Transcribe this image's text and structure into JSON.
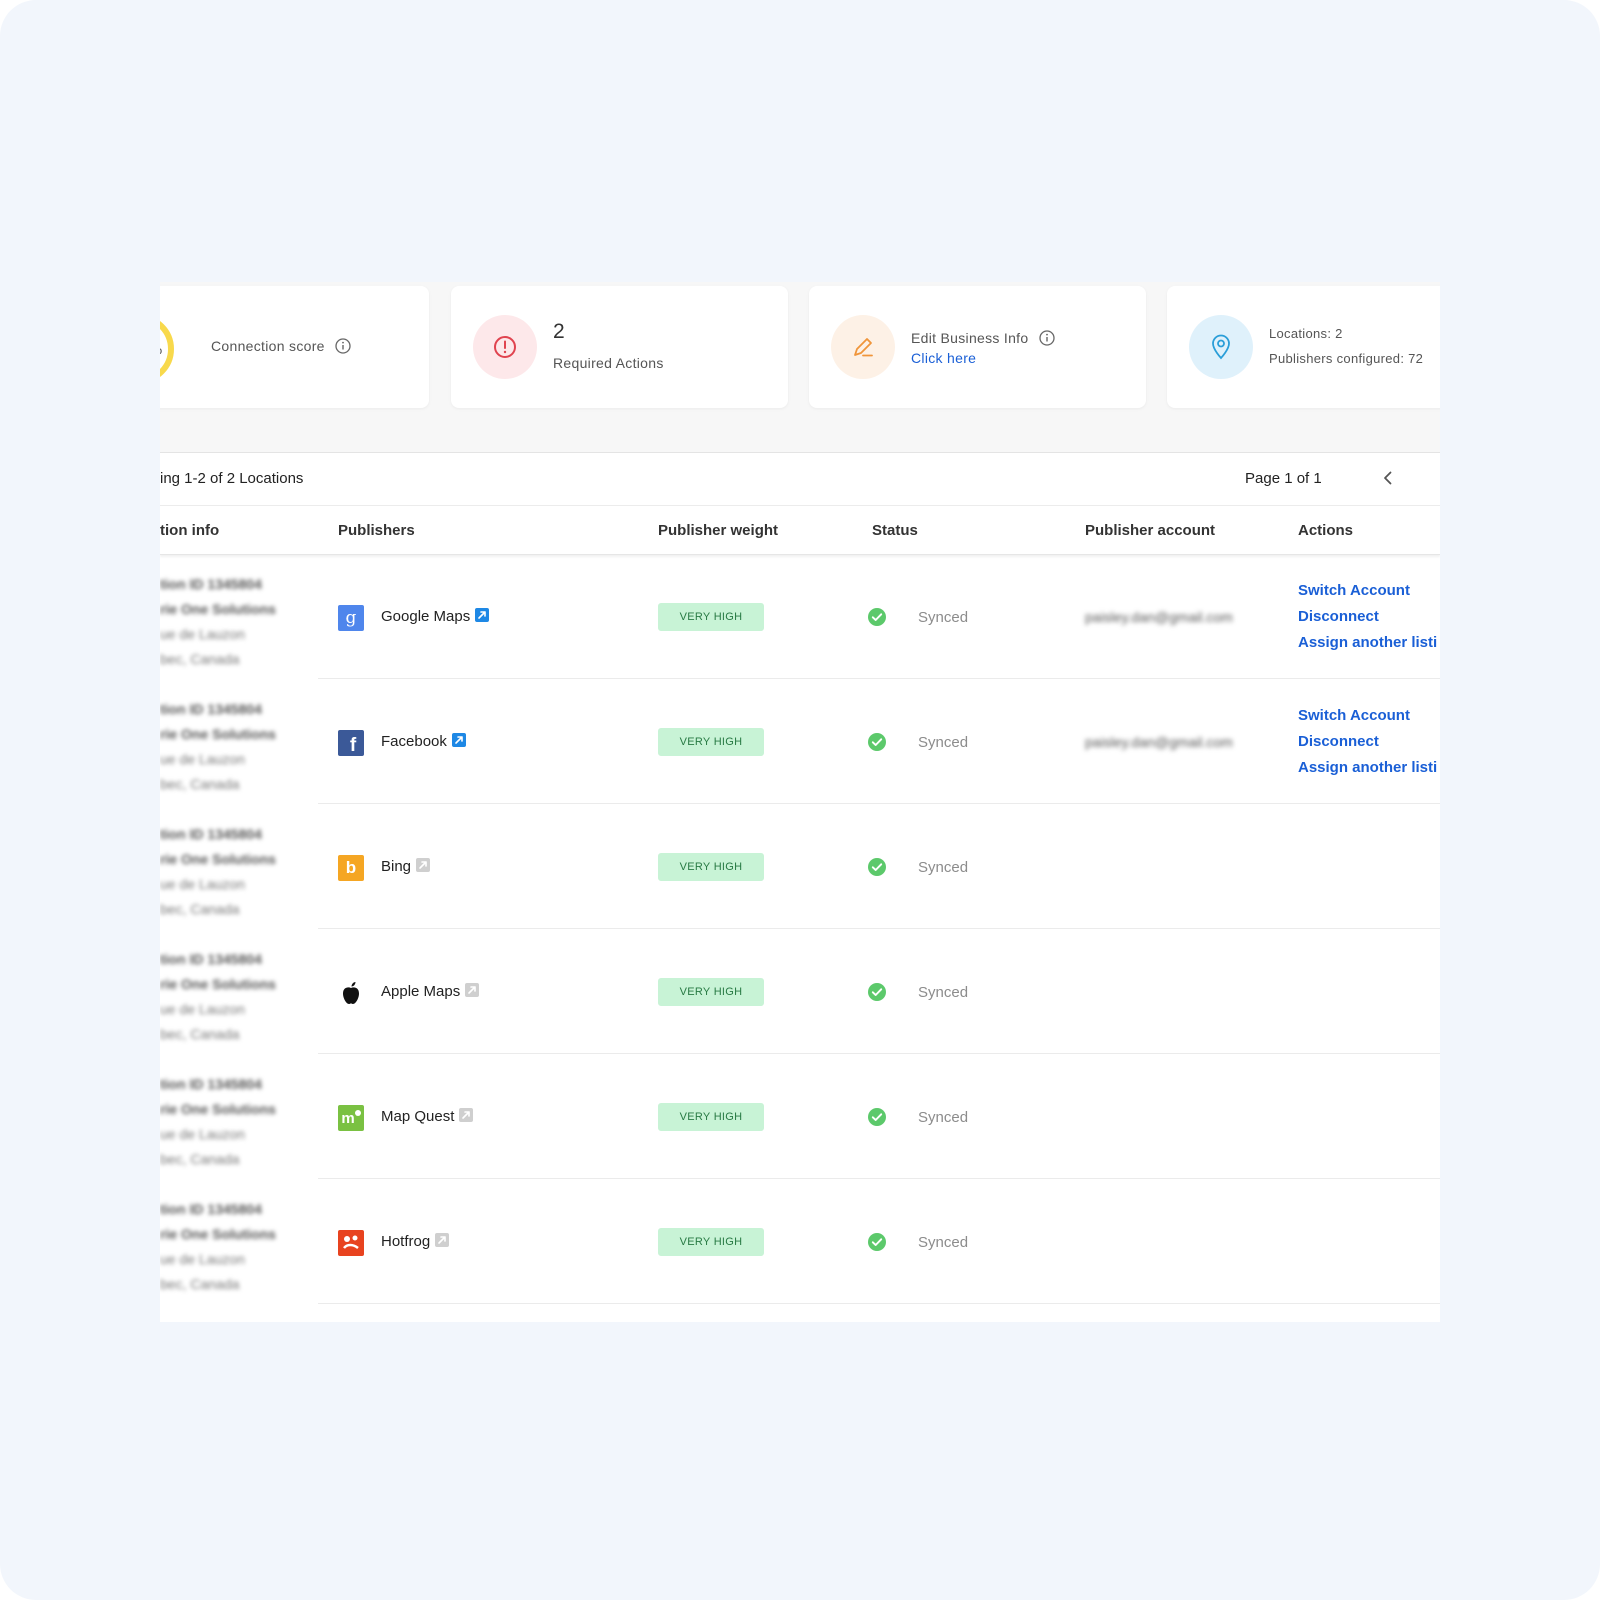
{
  "cards": {
    "score": {
      "percent_text": "%",
      "label": "Connection score"
    },
    "required": {
      "count": "2",
      "label": "Required Actions"
    },
    "edit": {
      "label": "Edit Business Info",
      "link": "Click here"
    },
    "locations": {
      "locations": "Locations: 2",
      "publishers": "Publishers configured: 72"
    }
  },
  "table": {
    "showing": "ing 1-2 of 2 Locations",
    "page": "Page 1 of 1",
    "headers": {
      "location": "tion info",
      "publishers": "Publishers",
      "weight": "Publisher weight",
      "status": "Status",
      "account": "Publisher account",
      "actions": "Actions"
    },
    "location_lines": [
      "tion ID 1345804",
      "rie One Solutions",
      "ue de Lauzon",
      "bec, Canada"
    ],
    "rows": [
      {
        "publisher": "Google Maps",
        "logo": "google-maps-logo",
        "link_active": true,
        "weight": "VERY HIGH",
        "status": "Synced",
        "account": "paisley.dan@gmail.com",
        "actions": [
          "Switch Account",
          "Disconnect",
          "Assign another listi"
        ]
      },
      {
        "publisher": "Facebook",
        "logo": "facebook-logo",
        "link_active": true,
        "weight": "VERY HIGH",
        "status": "Synced",
        "account": "paisley.dan@gmail.com",
        "actions": [
          "Switch Account",
          "Disconnect",
          "Assign another listi"
        ]
      },
      {
        "publisher": "Bing",
        "logo": "bing-logo",
        "link_active": false,
        "weight": "VERY HIGH",
        "status": "Synced",
        "account": "",
        "actions": []
      },
      {
        "publisher": "Apple Maps",
        "logo": "apple-logo",
        "link_active": false,
        "weight": "VERY HIGH",
        "status": "Synced",
        "account": "",
        "actions": []
      },
      {
        "publisher": "Map Quest",
        "logo": "mapquest-logo",
        "link_active": false,
        "weight": "VERY HIGH",
        "status": "Synced",
        "account": "",
        "actions": []
      },
      {
        "publisher": "Hotfrog",
        "logo": "hotfrog-logo",
        "link_active": false,
        "weight": "VERY HIGH",
        "status": "Synced",
        "account": "",
        "actions": []
      }
    ]
  },
  "colors": {
    "link": "#1a5fd6",
    "badge_bg": "#c8f3d6",
    "badge_text": "#287a44",
    "synced": "#5cc96b",
    "score_ring": "#f8d94c"
  }
}
